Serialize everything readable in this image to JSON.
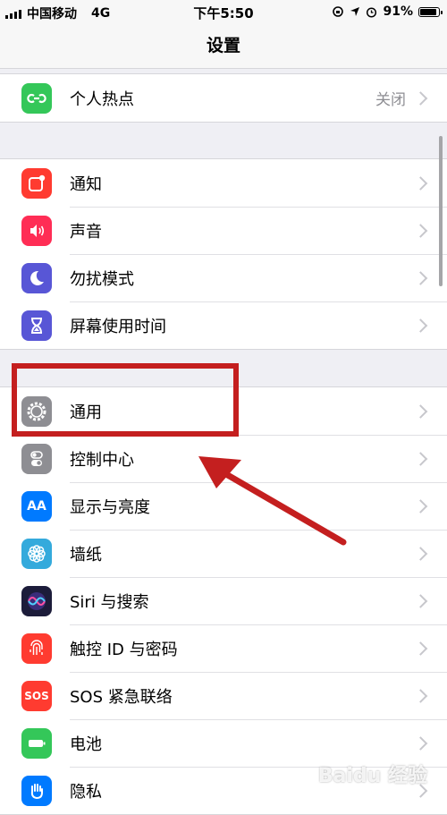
{
  "status_bar": {
    "carrier": "中国移动",
    "network": "4G",
    "time": "下午5:50",
    "battery": "91%",
    "battery_level": 0.91
  },
  "nav": {
    "title": "设置"
  },
  "hotspot_row": {
    "label": "个人热点",
    "value": "关闭",
    "icon": "hotspot-icon",
    "color": "#34c759"
  },
  "group2": [
    {
      "label": "通知",
      "icon": "notifications-icon",
      "color": "#ff3b30"
    },
    {
      "label": "声音",
      "icon": "sounds-icon",
      "color": "#ff2d55"
    },
    {
      "label": "勿扰模式",
      "icon": "moon-icon",
      "color": "#5856d6"
    },
    {
      "label": "屏幕使用时间",
      "icon": "hourglass-icon",
      "color": "#5856d6"
    }
  ],
  "group3": [
    {
      "label": "通用",
      "icon": "gear-icon",
      "color": "#8e8e93"
    },
    {
      "label": "控制中心",
      "icon": "toggles-icon",
      "color": "#8e8e93"
    },
    {
      "label": "显示与亮度",
      "icon": "display-icon",
      "color": "#007aff",
      "icon_text": "AA"
    },
    {
      "label": "墙纸",
      "icon": "wallpaper-icon",
      "color": "#34aadc"
    },
    {
      "label": "Siri 与搜索",
      "icon": "siri-icon",
      "color": "#1c1c3a"
    },
    {
      "label": "触控 ID 与密码",
      "icon": "fingerprint-icon",
      "color": "#ff3b30"
    },
    {
      "label": "SOS 紧急联络",
      "icon": "sos-icon",
      "color": "#ff3b30",
      "icon_text": "SOS"
    },
    {
      "label": "电池",
      "icon": "battery-icon",
      "color": "#34c759"
    },
    {
      "label": "隐私",
      "icon": "hand-icon",
      "color": "#007aff"
    }
  ],
  "annotation": {
    "color": "#c41f1f"
  },
  "watermark": "Baidu 经验"
}
